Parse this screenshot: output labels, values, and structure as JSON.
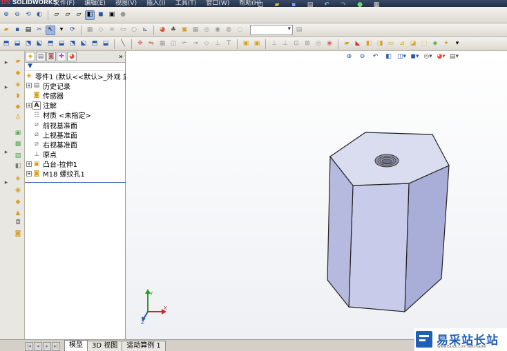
{
  "app": {
    "logo_prefix": "DS",
    "logo_name": "SOLIDWORKS"
  },
  "menu": [
    "文件(F)",
    "编辑(E)",
    "视图(V)",
    "插入(I)",
    "工具(T)",
    "窗口(W)",
    "帮助(H)"
  ],
  "feature_tree": {
    "more_label": "»",
    "root": "零件1  (默认<<默认>_外观 显",
    "items": [
      {
        "label": "历史记录",
        "icon": "history-icon",
        "expandable": true
      },
      {
        "label": "传感器",
        "icon": "sensor-icon",
        "expandable": false
      },
      {
        "label": "注解",
        "icon": "annotation-icon",
        "expandable": true
      },
      {
        "label": "材质 <未指定>",
        "icon": "material-icon",
        "expandable": false
      },
      {
        "label": "前视基准面",
        "icon": "plane-icon",
        "expandable": false
      },
      {
        "label": "上视基准面",
        "icon": "plane-icon",
        "expandable": false
      },
      {
        "label": "右视基准面",
        "icon": "plane-icon",
        "expandable": false
      },
      {
        "label": "原点",
        "icon": "origin-icon",
        "expandable": false
      },
      {
        "label": "凸台-拉伸1",
        "icon": "extrude-icon",
        "expandable": true
      },
      {
        "label": "M18 螺纹孔1",
        "icon": "hole-wizard-icon",
        "expandable": true
      }
    ]
  },
  "bottom_tabs": [
    "模型",
    "3D 视图",
    "运动算例 1"
  ],
  "triad": {
    "x": "X",
    "y": "Y",
    "z": "Z"
  },
  "watermark": {
    "title": "易采站长站",
    "subtitle": "Www.Easck.Com  Webmaster"
  },
  "colors": {
    "part_face_front": "#c4c8e8",
    "part_face_side": "#a8acd4",
    "part_face_top": "#d6d8ee",
    "accent": "#1f5fb8"
  }
}
